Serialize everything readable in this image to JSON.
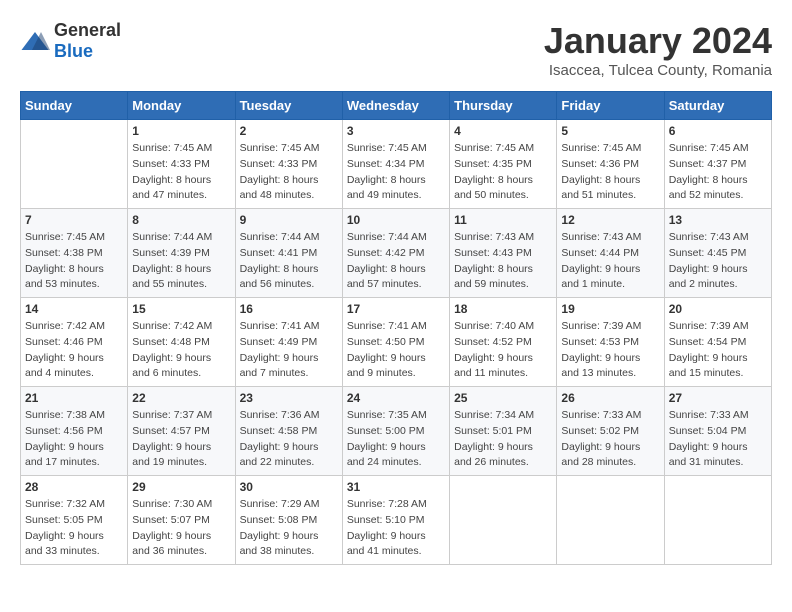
{
  "header": {
    "logo_general": "General",
    "logo_blue": "Blue",
    "month": "January 2024",
    "location": "Isaccea, Tulcea County, Romania"
  },
  "days_of_week": [
    "Sunday",
    "Monday",
    "Tuesday",
    "Wednesday",
    "Thursday",
    "Friday",
    "Saturday"
  ],
  "weeks": [
    [
      {
        "day": "",
        "info": ""
      },
      {
        "day": "1",
        "info": "Sunrise: 7:45 AM\nSunset: 4:33 PM\nDaylight: 8 hours\nand 47 minutes."
      },
      {
        "day": "2",
        "info": "Sunrise: 7:45 AM\nSunset: 4:33 PM\nDaylight: 8 hours\nand 48 minutes."
      },
      {
        "day": "3",
        "info": "Sunrise: 7:45 AM\nSunset: 4:34 PM\nDaylight: 8 hours\nand 49 minutes."
      },
      {
        "day": "4",
        "info": "Sunrise: 7:45 AM\nSunset: 4:35 PM\nDaylight: 8 hours\nand 50 minutes."
      },
      {
        "day": "5",
        "info": "Sunrise: 7:45 AM\nSunset: 4:36 PM\nDaylight: 8 hours\nand 51 minutes."
      },
      {
        "day": "6",
        "info": "Sunrise: 7:45 AM\nSunset: 4:37 PM\nDaylight: 8 hours\nand 52 minutes."
      }
    ],
    [
      {
        "day": "7",
        "info": "Sunrise: 7:45 AM\nSunset: 4:38 PM\nDaylight: 8 hours\nand 53 minutes."
      },
      {
        "day": "8",
        "info": "Sunrise: 7:44 AM\nSunset: 4:39 PM\nDaylight: 8 hours\nand 55 minutes."
      },
      {
        "day": "9",
        "info": "Sunrise: 7:44 AM\nSunset: 4:41 PM\nDaylight: 8 hours\nand 56 minutes."
      },
      {
        "day": "10",
        "info": "Sunrise: 7:44 AM\nSunset: 4:42 PM\nDaylight: 8 hours\nand 57 minutes."
      },
      {
        "day": "11",
        "info": "Sunrise: 7:43 AM\nSunset: 4:43 PM\nDaylight: 8 hours\nand 59 minutes."
      },
      {
        "day": "12",
        "info": "Sunrise: 7:43 AM\nSunset: 4:44 PM\nDaylight: 9 hours\nand 1 minute."
      },
      {
        "day": "13",
        "info": "Sunrise: 7:43 AM\nSunset: 4:45 PM\nDaylight: 9 hours\nand 2 minutes."
      }
    ],
    [
      {
        "day": "14",
        "info": "Sunrise: 7:42 AM\nSunset: 4:46 PM\nDaylight: 9 hours\nand 4 minutes."
      },
      {
        "day": "15",
        "info": "Sunrise: 7:42 AM\nSunset: 4:48 PM\nDaylight: 9 hours\nand 6 minutes."
      },
      {
        "day": "16",
        "info": "Sunrise: 7:41 AM\nSunset: 4:49 PM\nDaylight: 9 hours\nand 7 minutes."
      },
      {
        "day": "17",
        "info": "Sunrise: 7:41 AM\nSunset: 4:50 PM\nDaylight: 9 hours\nand 9 minutes."
      },
      {
        "day": "18",
        "info": "Sunrise: 7:40 AM\nSunset: 4:52 PM\nDaylight: 9 hours\nand 11 minutes."
      },
      {
        "day": "19",
        "info": "Sunrise: 7:39 AM\nSunset: 4:53 PM\nDaylight: 9 hours\nand 13 minutes."
      },
      {
        "day": "20",
        "info": "Sunrise: 7:39 AM\nSunset: 4:54 PM\nDaylight: 9 hours\nand 15 minutes."
      }
    ],
    [
      {
        "day": "21",
        "info": "Sunrise: 7:38 AM\nSunset: 4:56 PM\nDaylight: 9 hours\nand 17 minutes."
      },
      {
        "day": "22",
        "info": "Sunrise: 7:37 AM\nSunset: 4:57 PM\nDaylight: 9 hours\nand 19 minutes."
      },
      {
        "day": "23",
        "info": "Sunrise: 7:36 AM\nSunset: 4:58 PM\nDaylight: 9 hours\nand 22 minutes."
      },
      {
        "day": "24",
        "info": "Sunrise: 7:35 AM\nSunset: 5:00 PM\nDaylight: 9 hours\nand 24 minutes."
      },
      {
        "day": "25",
        "info": "Sunrise: 7:34 AM\nSunset: 5:01 PM\nDaylight: 9 hours\nand 26 minutes."
      },
      {
        "day": "26",
        "info": "Sunrise: 7:33 AM\nSunset: 5:02 PM\nDaylight: 9 hours\nand 28 minutes."
      },
      {
        "day": "27",
        "info": "Sunrise: 7:33 AM\nSunset: 5:04 PM\nDaylight: 9 hours\nand 31 minutes."
      }
    ],
    [
      {
        "day": "28",
        "info": "Sunrise: 7:32 AM\nSunset: 5:05 PM\nDaylight: 9 hours\nand 33 minutes."
      },
      {
        "day": "29",
        "info": "Sunrise: 7:30 AM\nSunset: 5:07 PM\nDaylight: 9 hours\nand 36 minutes."
      },
      {
        "day": "30",
        "info": "Sunrise: 7:29 AM\nSunset: 5:08 PM\nDaylight: 9 hours\nand 38 minutes."
      },
      {
        "day": "31",
        "info": "Sunrise: 7:28 AM\nSunset: 5:10 PM\nDaylight: 9 hours\nand 41 minutes."
      },
      {
        "day": "",
        "info": ""
      },
      {
        "day": "",
        "info": ""
      },
      {
        "day": "",
        "info": ""
      }
    ]
  ]
}
